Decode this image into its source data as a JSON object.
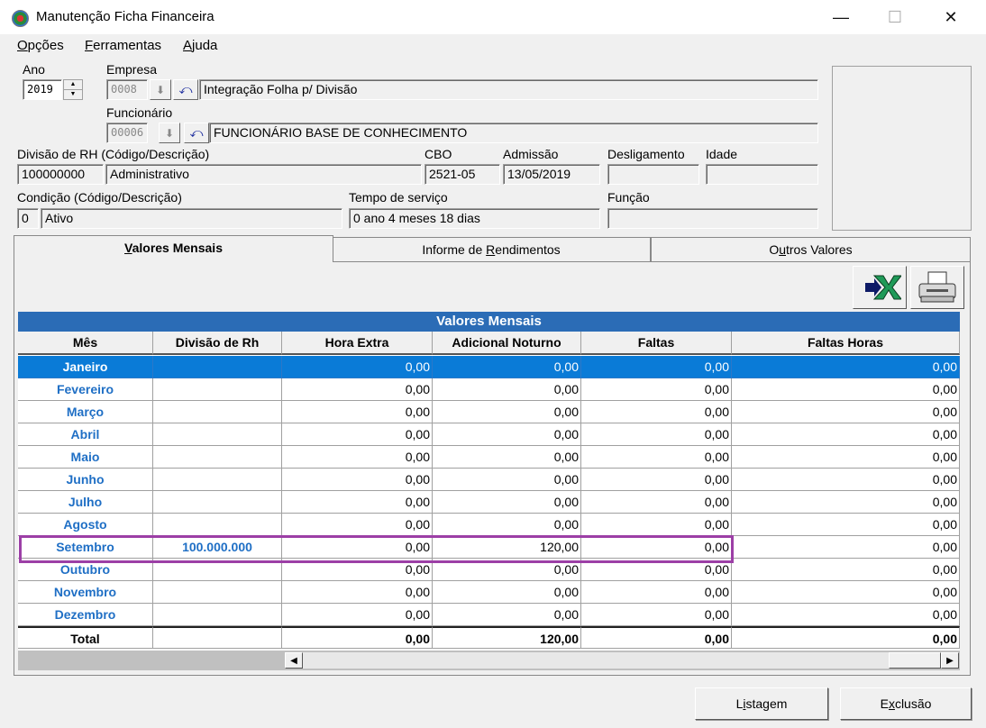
{
  "window": {
    "title": "Manutenção Ficha Financeira",
    "minimize": "—",
    "maximize": "☐",
    "close": "✕"
  },
  "menu": {
    "opcoes": "Opções",
    "ferramentas": "Ferramentas",
    "ajuda": "Ajuda"
  },
  "form": {
    "ano_label": "Ano",
    "ano_value": "2019",
    "empresa_label": "Empresa",
    "empresa_code": "0008",
    "empresa_name": "Integração Folha p/ Divisão",
    "funcionario_label": "Funcionário",
    "funcionario_code": "00006",
    "funcionario_name": "FUNCIONÁRIO BASE DE CONHECIMENTO",
    "divisao_label": "Divisão de RH (Código/Descrição)",
    "divisao_code": "100000000",
    "divisao_name": "Administrativo",
    "cbo_label": "CBO",
    "cbo_value": "2521-05",
    "admissao_label": "Admissão",
    "admissao_value": "13/05/2019",
    "desligamento_label": "Desligamento",
    "desligamento_value": "",
    "idade_label": "Idade",
    "idade_value": "",
    "condicao_label": "Condição (Código/Descrição)",
    "condicao_code": "0",
    "condicao_name": "Ativo",
    "tempo_label": "Tempo de serviço",
    "tempo_value": "0 ano 4 meses 18 dias",
    "funcao_label": "Função",
    "funcao_value": ""
  },
  "tabs": [
    {
      "label": "Valores Mensais",
      "accel": "V",
      "rest": "alores Mensais"
    },
    {
      "label": "Informe de Rendimentos",
      "pre": "Informe de ",
      "accel": "R",
      "rest": "endimentos"
    },
    {
      "label": "Outros Valores",
      "pre": "O",
      "accel": "u",
      "rest": "tros Valores"
    }
  ],
  "toolbar": {
    "excel_icon": "excel-export-icon",
    "print_icon": "printer-icon"
  },
  "grid": {
    "title": "Valores Mensais",
    "headers": [
      "Mês",
      "Divisão de Rh",
      "Hora Extra",
      "Adicional Noturno",
      "Faltas",
      "Faltas Horas"
    ],
    "rows": [
      [
        "Janeiro",
        "",
        "0,00",
        "0,00",
        "0,00",
        "0,00"
      ],
      [
        "Fevereiro",
        "",
        "0,00",
        "0,00",
        "0,00",
        "0,00"
      ],
      [
        "Março",
        "",
        "0,00",
        "0,00",
        "0,00",
        "0,00"
      ],
      [
        "Abril",
        "",
        "0,00",
        "0,00",
        "0,00",
        "0,00"
      ],
      [
        "Maio",
        "",
        "0,00",
        "0,00",
        "0,00",
        "0,00"
      ],
      [
        "Junho",
        "",
        "0,00",
        "0,00",
        "0,00",
        "0,00"
      ],
      [
        "Julho",
        "",
        "0,00",
        "0,00",
        "0,00",
        "0,00"
      ],
      [
        "Agosto",
        "",
        "0,00",
        "0,00",
        "0,00",
        "0,00"
      ],
      [
        "Setembro",
        "100.000.000",
        "0,00",
        "120,00",
        "0,00",
        "0,00"
      ],
      [
        "Outubro",
        "",
        "0,00",
        "0,00",
        "0,00",
        "0,00"
      ],
      [
        "Novembro",
        "",
        "0,00",
        "0,00",
        "0,00",
        "0,00"
      ],
      [
        "Dezembro",
        "",
        "0,00",
        "0,00",
        "0,00",
        "0,00"
      ]
    ],
    "total": [
      "Total",
      "",
      "0,00",
      "120,00",
      "0,00",
      "0,00"
    ]
  },
  "buttons": {
    "listagem": "Listagem",
    "listagem_accel": "i",
    "exclusao": "Exclusão",
    "exclusao_accel": "x"
  },
  "colors": {
    "selection": "#0a7bd7",
    "grid_title": "#2b6cb6",
    "highlight": "#9c3fa6",
    "month_text": "#1f6fc5"
  }
}
